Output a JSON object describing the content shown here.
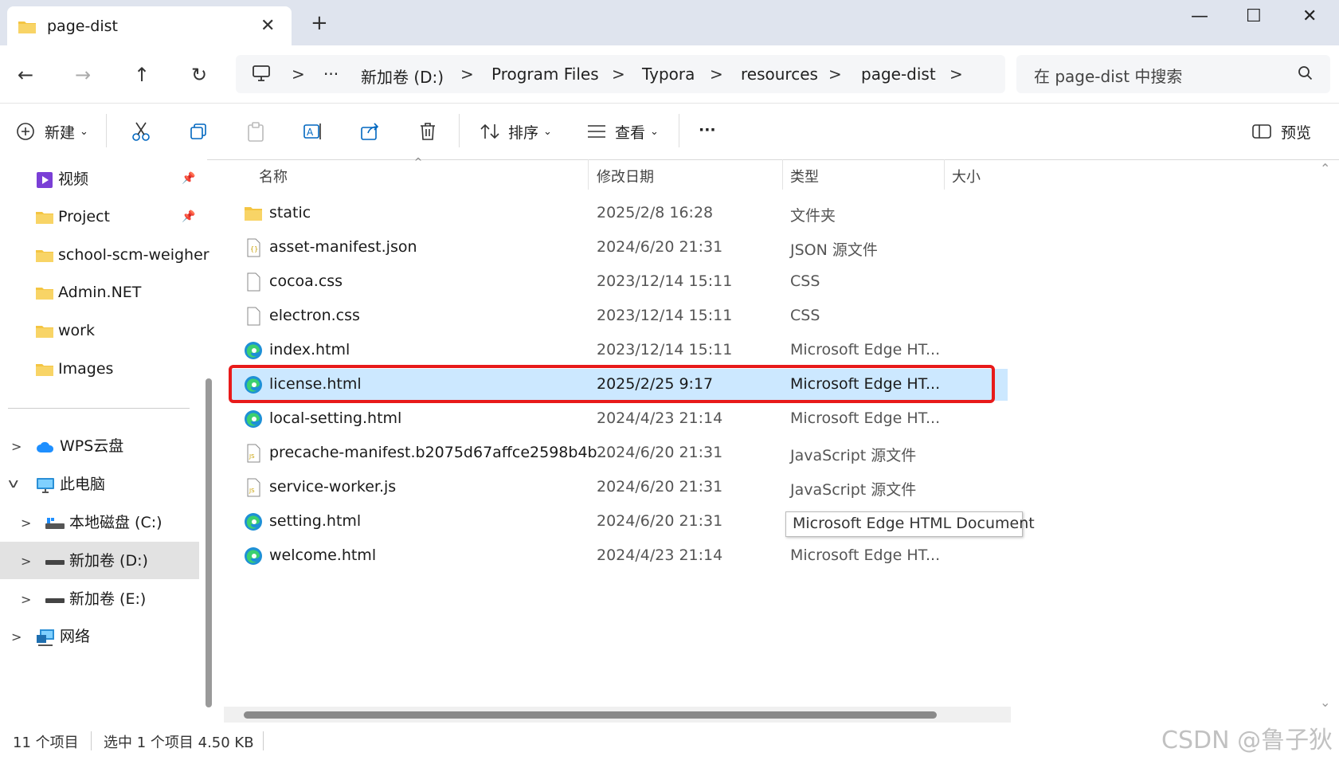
{
  "window": {
    "tab_title": "page-dist",
    "close_tab": "✕",
    "new_tab": "+",
    "minimize": "—",
    "maximize": "☐",
    "close": "✕"
  },
  "nav": {
    "back": "←",
    "forward": "→",
    "up": "↑",
    "refresh": "↻"
  },
  "breadcrumb": {
    "more": "···",
    "items": [
      "新加卷 (D:)",
      "Program Files",
      "Typora",
      "resources",
      "page-dist"
    ],
    "separator": ">"
  },
  "search": {
    "placeholder": "在 page-dist 中搜索"
  },
  "toolbar": {
    "new_label": "新建",
    "sort_label": "排序",
    "view_label": "查看",
    "more_label": "···",
    "preview_label": "预览"
  },
  "sidebar": {
    "quick_access": [
      {
        "label": "视频",
        "pinned": true,
        "icon": "video-folder-icon"
      },
      {
        "label": "Project",
        "pinned": true,
        "icon": "folder-icon"
      },
      {
        "label": "school-scm-weigher",
        "pinned": false,
        "icon": "folder-icon"
      },
      {
        "label": "Admin.NET",
        "pinned": false,
        "icon": "folder-icon"
      },
      {
        "label": "work",
        "pinned": false,
        "icon": "folder-icon"
      },
      {
        "label": "Images",
        "pinned": false,
        "icon": "folder-icon"
      }
    ],
    "tree": [
      {
        "label": "WPS云盘",
        "expander": ">",
        "icon": "cloud-icon"
      },
      {
        "label": "此电脑",
        "expander": "v",
        "icon": "computer-icon"
      },
      {
        "label": "本地磁盘 (C:)",
        "expander": ">",
        "icon": "drive-c-icon"
      },
      {
        "label": "新加卷 (D:)",
        "expander": ">",
        "icon": "drive-d-icon",
        "selected": true
      },
      {
        "label": "新加卷 (E:)",
        "expander": ">",
        "icon": "drive-e-icon"
      },
      {
        "label": "网络",
        "expander": ">",
        "icon": "network-icon"
      }
    ]
  },
  "columns": {
    "name": "名称",
    "date": "修改日期",
    "type": "类型",
    "size": "大小"
  },
  "files": [
    {
      "name": "static",
      "date": "2025/2/8 16:28",
      "type": "文件夹",
      "icon": "folder-icon"
    },
    {
      "name": "asset-manifest.json",
      "date": "2024/6/20 21:31",
      "type": "JSON 源文件",
      "icon": "json-file-icon"
    },
    {
      "name": "cocoa.css",
      "date": "2023/12/14 15:11",
      "type": "CSS",
      "icon": "css-file-icon"
    },
    {
      "name": "electron.css",
      "date": "2023/12/14 15:11",
      "type": "CSS",
      "icon": "css-file-icon"
    },
    {
      "name": "index.html",
      "date": "2023/12/14 15:11",
      "type": "Microsoft Edge HT...",
      "icon": "edge-icon"
    },
    {
      "name": "license.html",
      "date": "2025/2/25 9:17",
      "type": "Microsoft Edge HT...",
      "icon": "edge-icon",
      "selected": true
    },
    {
      "name": "local-setting.html",
      "date": "2024/4/23 21:14",
      "type": "Microsoft Edge HT...",
      "icon": "edge-icon"
    },
    {
      "name": "precache-manifest.b2075d67affce2598b4b...",
      "date": "2024/6/20 21:31",
      "type": "JavaScript 源文件",
      "icon": "js-file-icon"
    },
    {
      "name": "service-worker.js",
      "date": "2024/6/20 21:31",
      "type": "JavaScript 源文件",
      "icon": "js-file-icon"
    },
    {
      "name": "setting.html",
      "date": "2024/6/20 21:31",
      "type": "",
      "icon": "edge-icon"
    },
    {
      "name": "welcome.html",
      "date": "2024/4/23 21:14",
      "type": "Microsoft Edge HT...",
      "icon": "edge-icon"
    }
  ],
  "tooltip": "Microsoft Edge HTML Document",
  "status": {
    "count": "11 个项目",
    "selection": "选中 1 个项目  4.50 KB"
  },
  "watermark": "CSDN @鲁子狄",
  "colors": {
    "accent": "#0067c0",
    "selected_row": "#cce8ff",
    "highlight_box": "#e81a1a",
    "folder": "#f4c542"
  }
}
